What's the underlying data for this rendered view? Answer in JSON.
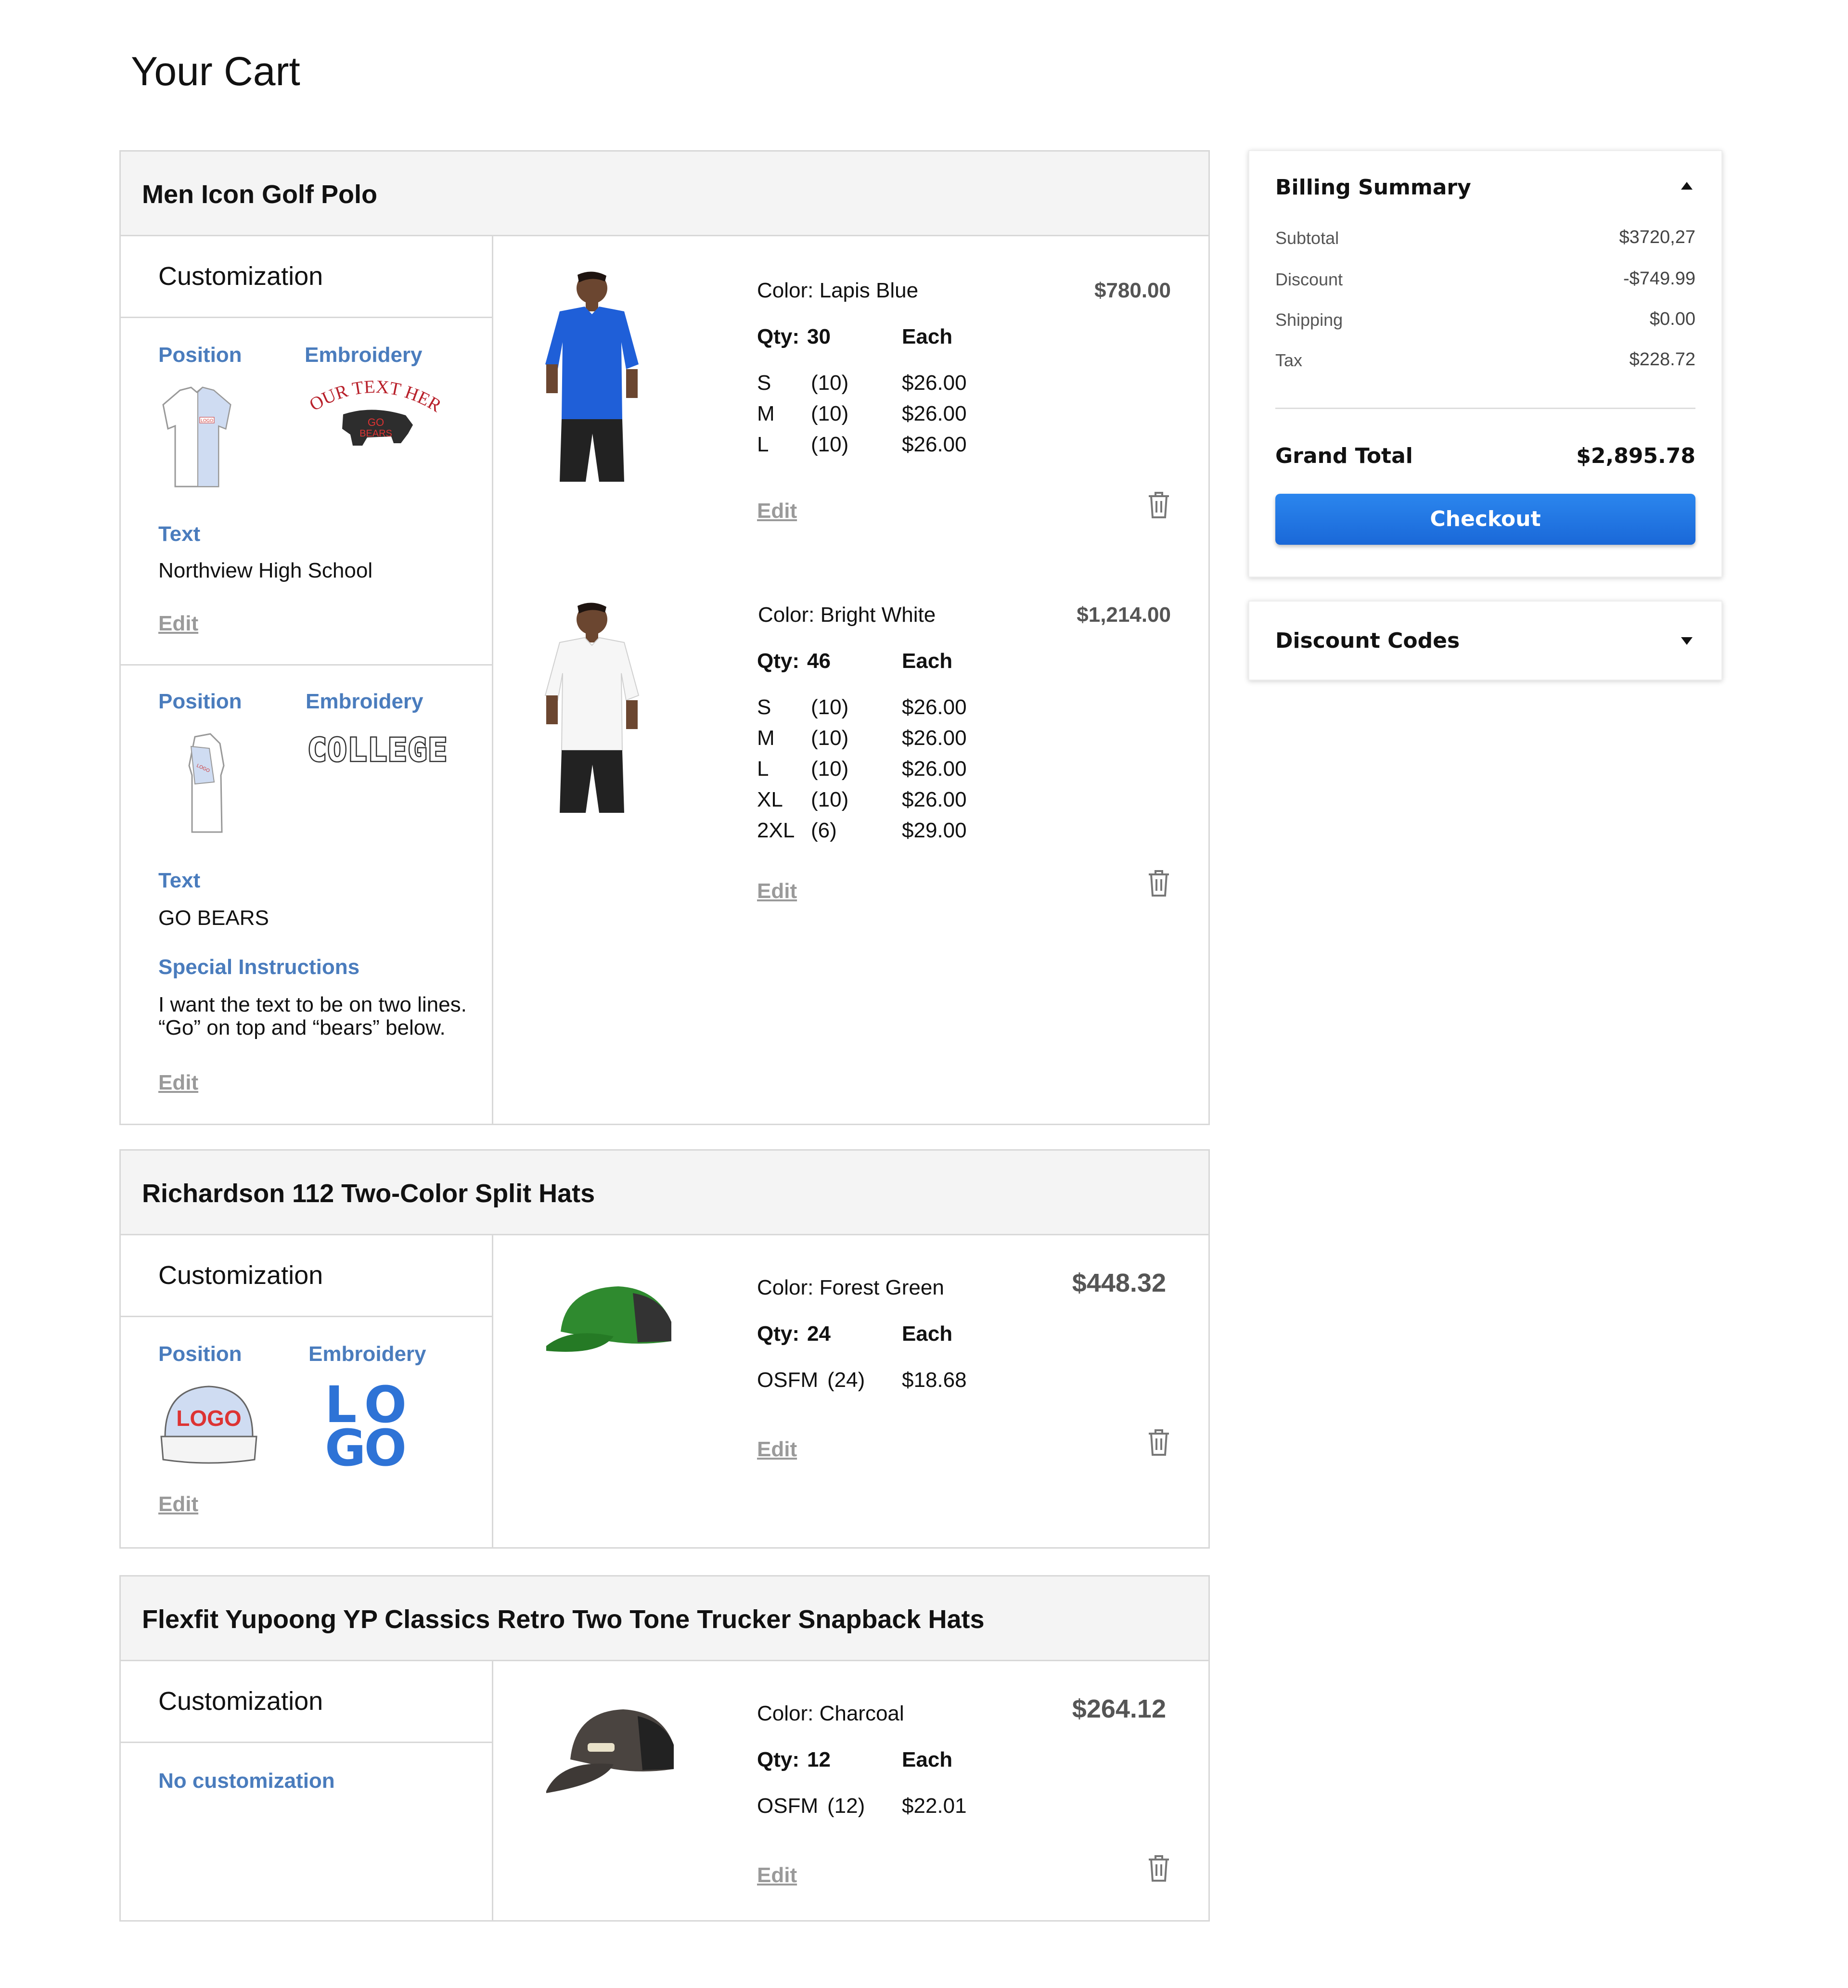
{
  "page": {
    "title": "Your Cart"
  },
  "common": {
    "customization_label": "Customization",
    "position_label": "Position",
    "embroidery_label": "Embroidery",
    "text_label": "Text",
    "special_label": "Special Instructions",
    "edit_label": "Edit",
    "qty_prefix": "Qty:",
    "each_label": "Each"
  },
  "items": [
    {
      "name": "Men Icon Golf Polo",
      "customizations": [
        {
          "text": "Northview High School",
          "embroidery_art": [
            "YOUR TEXT HERE",
            "GO",
            "BEARS"
          ],
          "position_logo": "LOGO"
        },
        {
          "text": "GO BEARS",
          "embroidery_art": [
            "COLLEGE"
          ],
          "position_logo": "LOGO",
          "special": [
            "I want the text to be on two lines.",
            "“Go” on top and “bears” below."
          ]
        }
      ],
      "lines": [
        {
          "color": "Color: Lapis Blue",
          "qty": "30",
          "price": "$780.00",
          "sizes": [
            {
              "size": "S",
              "count": "(10)",
              "price": "$26.00"
            },
            {
              "size": "M",
              "count": "(10)",
              "price": "$26.00"
            },
            {
              "size": "L",
              "count": "(10)",
              "price": "$26.00"
            }
          ]
        },
        {
          "color": "Color: Bright White",
          "qty": "46",
          "price": "$1,214.00",
          "sizes": [
            {
              "size": "S",
              "count": "(10)",
              "price": "$26.00"
            },
            {
              "size": "M",
              "count": "(10)",
              "price": "$26.00"
            },
            {
              "size": "L",
              "count": "(10)",
              "price": "$26.00"
            },
            {
              "size": "XL",
              "count": "(10)",
              "price": "$26.00"
            },
            {
              "size": "2XL",
              "count": "(6)",
              "price": "$29.00"
            }
          ]
        }
      ]
    },
    {
      "name": "Richardson 112 Two-Color Split Hats",
      "customizations": [
        {
          "position_logo": "LOGO",
          "embroidery_art": [
            "LO",
            "GO"
          ]
        }
      ],
      "lines": [
        {
          "color": "Color: Forest Green",
          "qty": "24",
          "price": "$448.32",
          "sizes": [
            {
              "size": "OSFM",
              "count": "(24)",
              "price": "$18.68"
            }
          ]
        }
      ]
    },
    {
      "name": "Flexfit Yupoong YP Classics Retro Two Tone Trucker Snapback Hats",
      "no_customization": "No customization",
      "lines": [
        {
          "color": "Color: Charcoal",
          "qty": "12",
          "price": "$264.12",
          "sizes": [
            {
              "size": "OSFM",
              "count": "(12)",
              "price": "$22.01"
            }
          ]
        }
      ]
    }
  ],
  "billing": {
    "title": "Billing Summary",
    "rows": [
      {
        "label": "Subtotal",
        "value": "$3720,27"
      },
      {
        "label": "Discount",
        "value": "-$749.99"
      },
      {
        "label": "Shipping",
        "value": "$0.00"
      },
      {
        "label": "Tax",
        "value": "$228.72"
      }
    ],
    "grand_total_label": "Grand Total",
    "grand_total": "$2,895.78",
    "checkout_label": "Checkout"
  },
  "discount": {
    "title": "Discount Codes"
  },
  "colors": {
    "accent": "#4a7cbd",
    "checkout": "#1f74e0",
    "border": "#d8d8d8",
    "header_bg": "#f4f4f4"
  },
  "icons": {
    "trash": "trash-icon",
    "collapse": "caret-up-icon",
    "expand": "caret-down-icon"
  }
}
